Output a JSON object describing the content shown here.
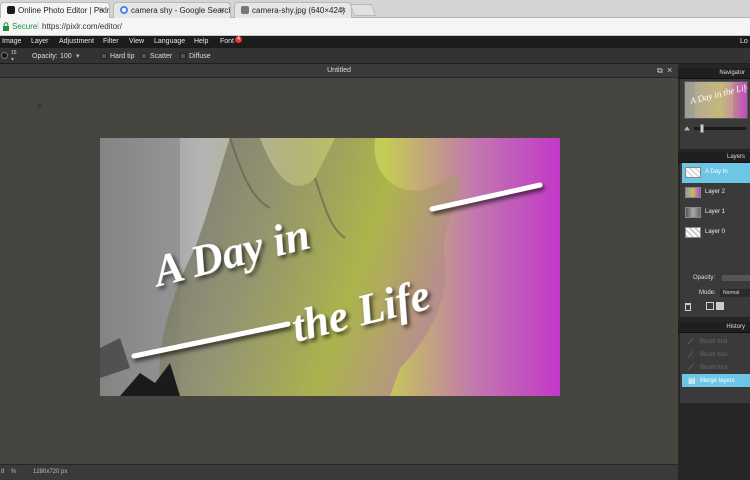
{
  "browser": {
    "tabs": [
      {
        "label": "Online Photo Editor | Pixlr Edi",
        "favicon_color": "#1a1a1a"
      },
      {
        "label": "camera shy - Google Search",
        "favicon_color": "#4285f4"
      },
      {
        "label": "camera-shy.jpg (640×424)",
        "favicon_color": "#777777"
      }
    ],
    "close_glyph": "×",
    "secure_label": "Secure",
    "url": "https://pixlr.com/editor/"
  },
  "menu": {
    "items": [
      "Image",
      "Layer",
      "Adjustment",
      "Filter",
      "View",
      "Language",
      "Help",
      "Font"
    ],
    "font_badge": "4",
    "right_text": "Lo"
  },
  "tool_options": {
    "brush_size": "15",
    "opacity_label": "Opacity:",
    "opacity_value": "100",
    "dropdown_glyph": "▾",
    "hard_tip_label": "Hard tip",
    "scatter_label": "Scatter",
    "diffuse_label": "Diffuse"
  },
  "document": {
    "title": "Untitled",
    "canvas_text_line1": "A Day in",
    "canvas_text_line2": "the Life",
    "zoom_value": "8",
    "zoom_unit": "%",
    "dimensions": "1280x720 px",
    "restore_glyph": "⧉",
    "close_glyph": "×"
  },
  "navigator": {
    "title": "Navigator",
    "preview_text": "A Day in the Life"
  },
  "layers": {
    "title": "Layers",
    "items": [
      {
        "name": "A Day In",
        "selected": true
      },
      {
        "name": "Layer 2",
        "selected": false
      },
      {
        "name": "Layer 1",
        "selected": false
      },
      {
        "name": "Layer 0",
        "selected": false
      }
    ],
    "opacity_label": "Opacity:",
    "mode_label": "Mode:",
    "mode_value": "Normal"
  },
  "history": {
    "title": "History",
    "items": [
      {
        "name": "Brush tool",
        "active": false
      },
      {
        "name": "Brush tool",
        "active": false
      },
      {
        "name": "Brush tool",
        "active": false
      },
      {
        "name": "Merge layers",
        "active": true
      }
    ]
  },
  "colors": {
    "accent": "#6ec6e6",
    "menubar": "#1c1c1c",
    "workspace": "#474540"
  }
}
